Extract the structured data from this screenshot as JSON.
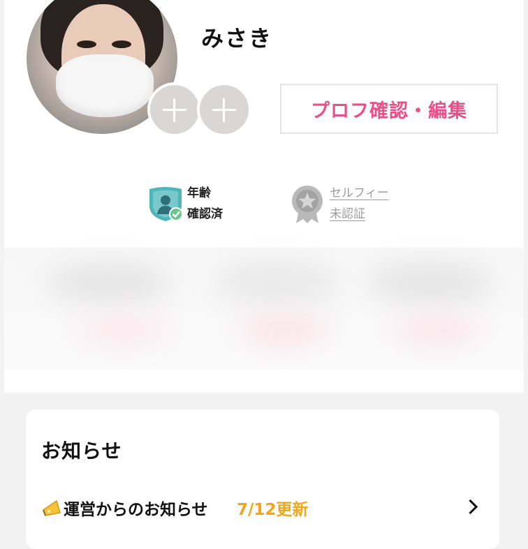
{
  "profile": {
    "name": "みさき",
    "edit_button_label": "プロフ確認・編集"
  },
  "badges": {
    "age": {
      "line1": "年齢",
      "line2": "確認済",
      "icon": "shield-person-check-icon",
      "color": "#4cb6b8"
    },
    "selfie": {
      "line1": "セルフィー",
      "line2": "未認証",
      "icon": "star-medal-icon",
      "color": "#b9b9b9"
    }
  },
  "notice": {
    "title": "お知らせ",
    "item_label": "運営からのお知らせ",
    "item_updated": "7/12更新",
    "item_icon": "megaphone-icon"
  },
  "colors": {
    "accent_pink": "#ec4f87",
    "accent_orange": "#f2a51c",
    "background": "#f2f2f2"
  }
}
